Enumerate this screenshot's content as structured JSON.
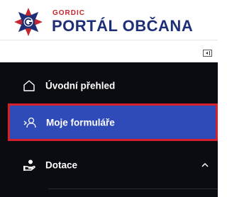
{
  "brand": {
    "company": "GORDIC",
    "title": "PORTÁL OBČANA"
  },
  "sidebar": {
    "items": [
      {
        "label": "Úvodní přehled",
        "icon": "home-icon"
      },
      {
        "label": "Moje formuláře",
        "icon": "user-forms-icon",
        "selected": true
      },
      {
        "label": "Dotace",
        "icon": "hand-coin-icon",
        "expandable": true
      }
    ]
  },
  "colors": {
    "brand_blue": "#1e2f78",
    "brand_red": "#c4262e",
    "sidebar_bg": "#0b0b12",
    "selected_bg": "#2f4bb7",
    "selected_border": "#d5202c"
  }
}
